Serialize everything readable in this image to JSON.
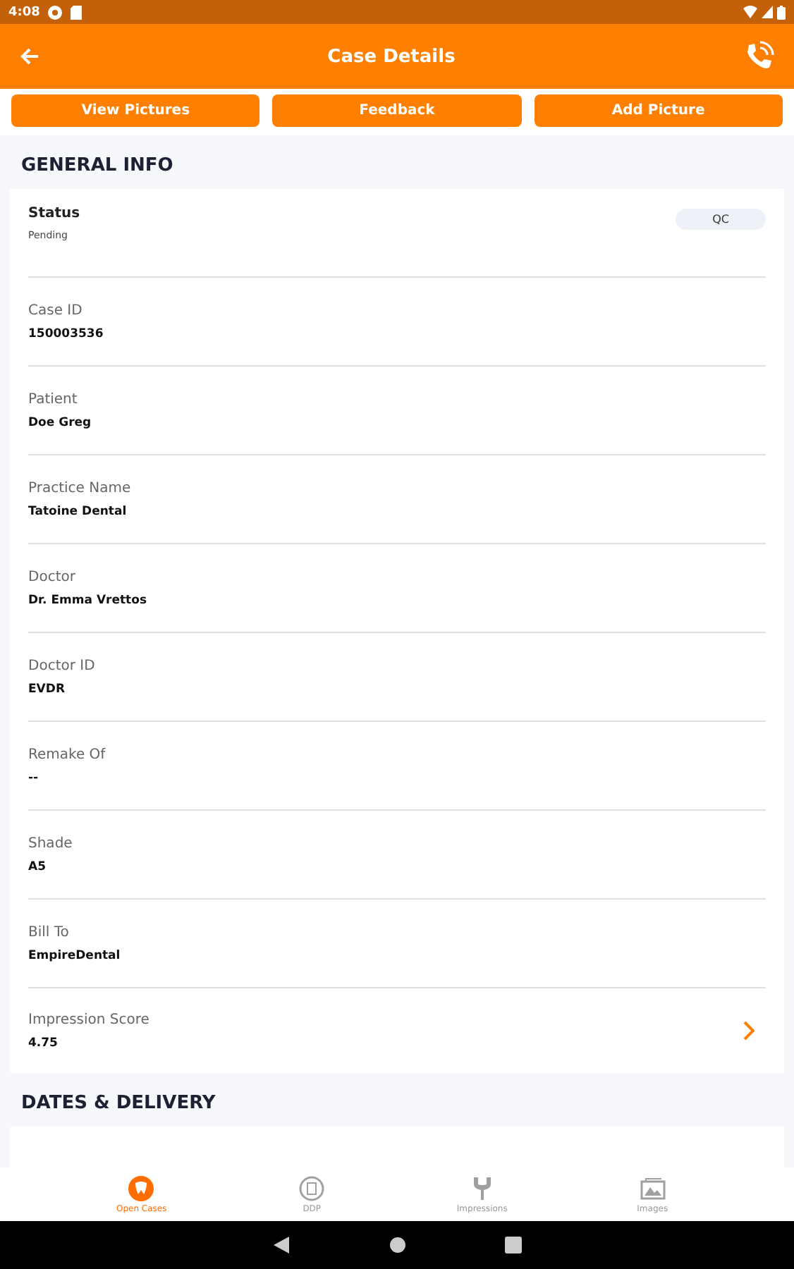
{
  "status_bar": {
    "time": "4:08"
  },
  "app_bar": {
    "title": "Case Details"
  },
  "actions": [
    "View Pictures",
    "Feedback",
    "Add Picture"
  ],
  "sections": [
    {
      "title": "GENERAL INFO",
      "rows": [
        {
          "kind": "status",
          "label": "Status",
          "value": "Pending",
          "badge": "QC"
        },
        {
          "kind": "field",
          "label": "Case ID",
          "value": "150003536"
        },
        {
          "kind": "field",
          "label": "Patient",
          "value": "Doe Greg"
        },
        {
          "kind": "field",
          "label": "Practice Name",
          "value": "Tatoine Dental"
        },
        {
          "kind": "field",
          "label": "Doctor",
          "value": "Dr. Emma Vrettos"
        },
        {
          "kind": "field",
          "label": "Doctor ID",
          "value": "EVDR"
        },
        {
          "kind": "field",
          "label": "Remake Of",
          "value": "--"
        },
        {
          "kind": "field",
          "label": "Shade",
          "value": "A5"
        },
        {
          "kind": "field",
          "label": "Bill To",
          "value": "EmpireDental"
        },
        {
          "kind": "link",
          "label": "Impression Score",
          "value": "4.75"
        }
      ]
    },
    {
      "title": "DATES & DELIVERY"
    }
  ],
  "bottom_nav": [
    {
      "kind": "tooth",
      "label": "Open Cases",
      "selected": true
    },
    {
      "kind": "ddp",
      "label": "DDP",
      "selected": false
    },
    {
      "kind": "fork",
      "label": "Impressions",
      "selected": false
    },
    {
      "kind": "images",
      "label": "Images",
      "selected": false
    }
  ]
}
